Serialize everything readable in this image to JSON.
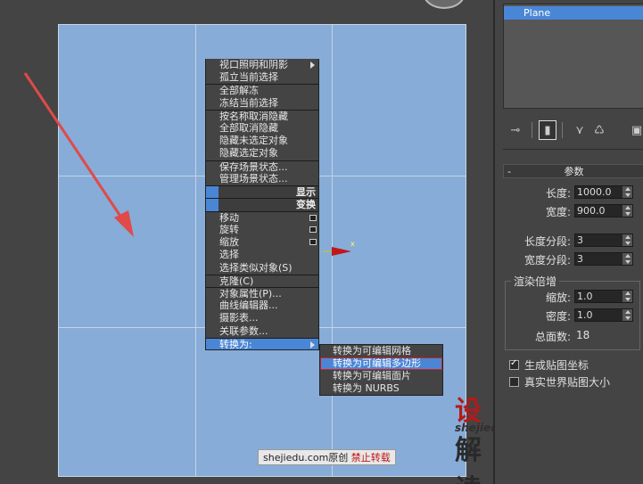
{
  "quad_menu": {
    "section1": [
      "视口照明和阴影",
      "孤立当前选择"
    ],
    "section2": [
      "全部解冻",
      "冻结当前选择"
    ],
    "section3": [
      "按名称取消隐藏",
      "全部取消隐藏",
      "隐藏未选定对象",
      "隐藏选定对象"
    ],
    "section4": [
      "保存场景状态...",
      "管理场景状态..."
    ],
    "quad_display": "显示",
    "quad_transform": "变换",
    "section5": [
      "移动",
      "旋转",
      "缩放",
      "选择",
      "选择类似对象(S)"
    ],
    "section6": [
      "克隆(C)"
    ],
    "section7": [
      "对象属性(P)...",
      "曲线编辑器...",
      "摄影表...",
      "关联参数..."
    ],
    "convert_to": "转换为:"
  },
  "submenu": {
    "items": [
      "转换为可编辑网格",
      "转换为可编辑多边形",
      "转换为可编辑面片",
      "转换为 NURBS"
    ],
    "highlighted_index": 1
  },
  "gizmo": {
    "axis_label": "x"
  },
  "watermark": {
    "logo_red": "设",
    "logo_rest": "解读",
    "url": "shejiedu.com",
    "footer_site": "shejiedu.com原创",
    "footer_warning": "禁止转载"
  },
  "panel": {
    "object_name": "Plane",
    "rollout_title": "参数",
    "length_label": "长度:",
    "length_value": "1000.0",
    "width_label": "宽度:",
    "width_value": "900.0",
    "length_segs_label": "长度分段:",
    "length_segs_value": "3",
    "width_segs_label": "宽度分段:",
    "width_segs_value": "3",
    "render_group": "渲染倍增",
    "scale_label": "缩放:",
    "scale_value": "1.0",
    "density_label": "密度:",
    "density_value": "1.0",
    "total_faces_label": "总面数:",
    "total_faces_value": "18",
    "gen_mapping_label": "生成贴图坐标",
    "gen_mapping_checked": true,
    "real_world_label": "真实世界贴图大小",
    "real_world_checked": false
  },
  "colors": {
    "highlight": "#4a86d6",
    "plane": "#87acd8",
    "annotation_arrow": "#e04a4a"
  }
}
